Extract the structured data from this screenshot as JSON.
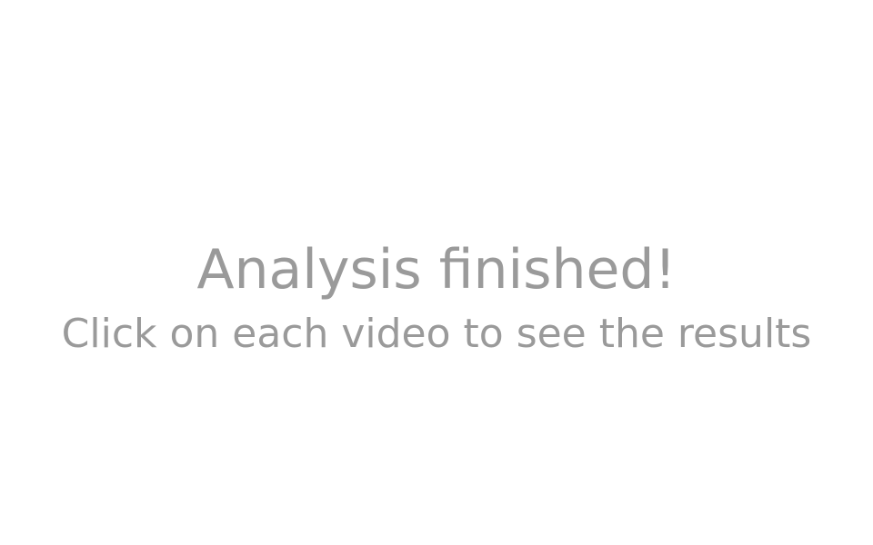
{
  "message": {
    "title": "Analysis finished!",
    "subtitle": "Click on each video to see the results"
  }
}
